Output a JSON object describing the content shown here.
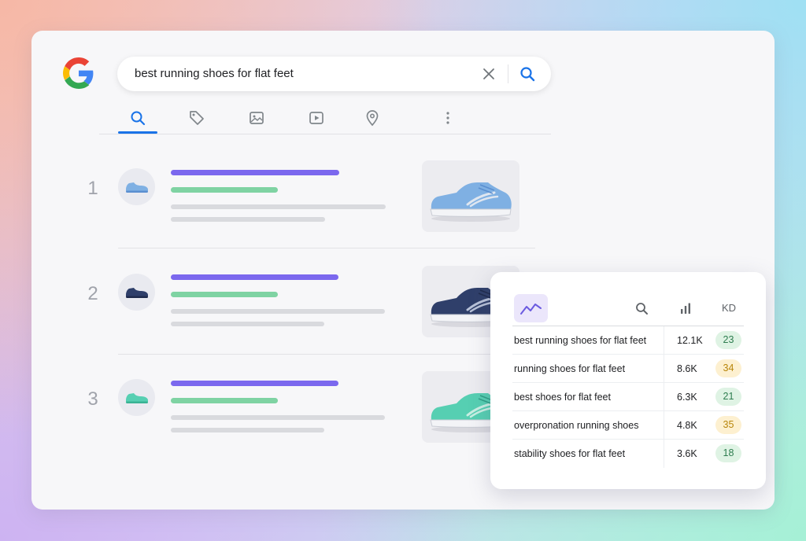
{
  "search": {
    "query": "best running shoes for flat feet"
  },
  "tabs": [
    {
      "icon": "search-icon",
      "active": true
    },
    {
      "icon": "tag-icon",
      "active": false
    },
    {
      "icon": "image-icon",
      "active": false
    },
    {
      "icon": "video-icon",
      "active": false
    },
    {
      "icon": "location-pin-icon",
      "active": false
    },
    {
      "icon": "more-vertical-icon",
      "active": false
    }
  ],
  "results": [
    {
      "rank": "1",
      "shoe_color": "#7fb0e3"
    },
    {
      "rank": "2",
      "shoe_color": "#2f3f6a"
    },
    {
      "rank": "3",
      "shoe_color": "#56cfb2"
    }
  ],
  "keyword_panel": {
    "kd_header": "KD",
    "rows": [
      {
        "keyword": "best running shoes for flat feet",
        "volume": "12.1K",
        "kd": "23",
        "level": "easy"
      },
      {
        "keyword": "running shoes for flat feet",
        "volume": "8.6K",
        "kd": "34",
        "level": "mid"
      },
      {
        "keyword": "best shoes for flat feet",
        "volume": "6.3K",
        "kd": "21",
        "level": "easy"
      },
      {
        "keyword": "overpronation running shoes",
        "volume": "4.8K",
        "kd": "35",
        "level": "mid"
      },
      {
        "keyword": "stability shoes for flat feet",
        "volume": "3.6K",
        "kd": "18",
        "level": "easy"
      }
    ]
  },
  "colors": {
    "accent_blue": "#1a73e8",
    "title_bar": "#7b68ee",
    "url_bar": "#7fd3a3",
    "kd_easy_bg": "#dff3e4",
    "kd_mid_bg": "#fdf0d0"
  }
}
